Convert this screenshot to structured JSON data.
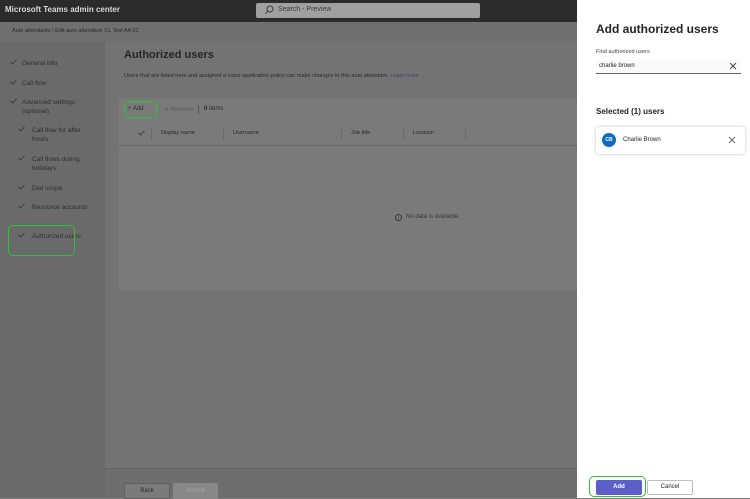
{
  "app": {
    "title": "Microsoft Teams admin center"
  },
  "search": {
    "placeholder": "Search - Preview"
  },
  "breadcrumb": "Auto attendants \\ Edit auto attendant: CL Test AA 01",
  "nav": {
    "items": [
      {
        "label": "General info"
      },
      {
        "label": "Call flow"
      },
      {
        "label": "Advanced settings (optional)"
      },
      {
        "label": "Call flow for after hours"
      },
      {
        "label": "Call flows during holidays"
      },
      {
        "label": "Dial scope"
      },
      {
        "label": "Resource accounts"
      },
      {
        "label": "Authorized users"
      }
    ]
  },
  "main": {
    "title": "Authorized users",
    "description": "Users that are listed here and assigned a voice application policy can make changes to this auto attendant.",
    "learn_more": "Learn more",
    "toolbar": {
      "add": "Add",
      "remove": "Remove",
      "count": "0",
      "count_suffix": "items"
    },
    "columns": [
      "Display name",
      "Username",
      "Job title",
      "Location"
    ],
    "empty": "No data is available."
  },
  "footer": {
    "back": "Back",
    "submit": "Submit"
  },
  "side_panel": {
    "title": "Add authorized users",
    "find_label": "Find authorized users",
    "find_value": "charlie brown",
    "selected_title": "Selected (1) users",
    "selected_users": [
      {
        "initials": "CB",
        "name": "Charlie Brown"
      }
    ],
    "add_button": "Add",
    "cancel_button": "Cancel"
  },
  "colors": {
    "accent": "#5b5fc7",
    "avatar": "#0f6cbd",
    "highlight": "#2fbf3a"
  }
}
